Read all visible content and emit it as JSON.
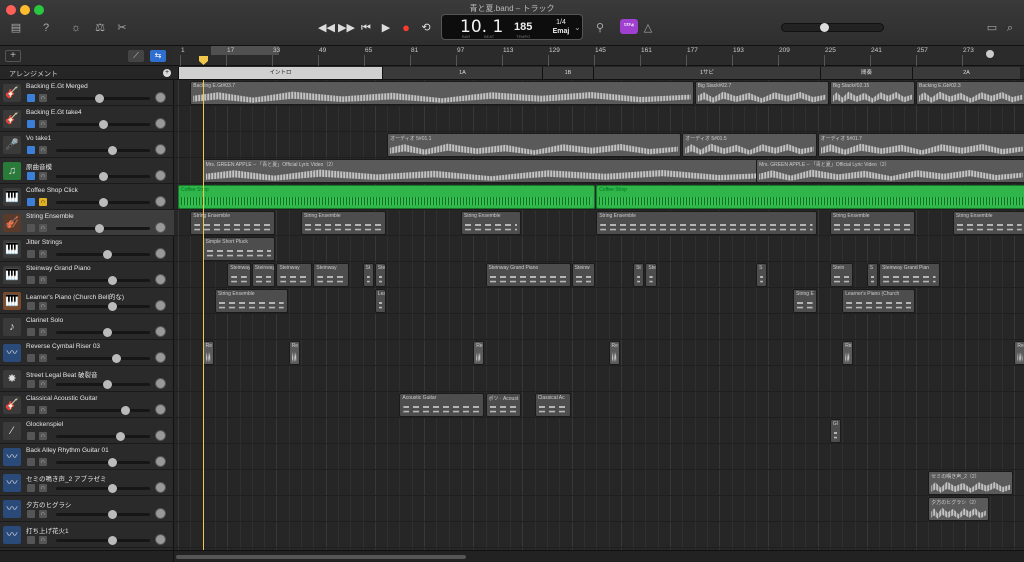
{
  "window": {
    "title": "青と夏.band – トラック"
  },
  "toolbar": {
    "library_icon": "library-icon",
    "help_icon": "help-icon",
    "smart_controls_icon": "smart-controls-icon",
    "editors_icon": "editors-icon",
    "lcd": {
      "position": "10. 1",
      "bar_label": "BAR",
      "beat_label": "BEAT",
      "tempo": "185",
      "tempo_label": "TEMPO",
      "signature": "1/4",
      "key": "Emaj"
    },
    "count_in_badge": "¹²³⁴",
    "volume_level": 0.4
  },
  "header": {
    "arrangement_label": "アレンジメント"
  },
  "ruler": {
    "ticks": [
      "1",
      "17",
      "33",
      "49",
      "65",
      "81",
      "97",
      "113",
      "129",
      "145",
      "161",
      "177",
      "193",
      "209",
      "225",
      "241",
      "257",
      "273"
    ]
  },
  "sections": [
    {
      "label": "イントロ"
    },
    {
      "label": "1A"
    },
    {
      "label": "1B"
    },
    {
      "label": "1サビ"
    },
    {
      "label": "間奏"
    },
    {
      "label": "2A"
    }
  ],
  "tracks": [
    {
      "name": "Backing E.Gt Merged",
      "icon": "🎸",
      "icon_bg": "#3a3a3a",
      "mute_on": true,
      "solo_on": false,
      "vol": 0.45
    },
    {
      "name": "Backing E.Gt take4",
      "icon": "🎸",
      "icon_bg": "#3a3a3a",
      "mute_on": true,
      "solo_on": false,
      "vol": 0.5
    },
    {
      "name": "Vo take1",
      "icon": "🎤",
      "icon_bg": "#3a3a3a",
      "mute_on": true,
      "solo_on": false,
      "vol": 0.6
    },
    {
      "name": "原曲音模",
      "icon": "♫",
      "icon_bg": "#2a7a3a",
      "mute_on": true,
      "solo_on": false,
      "vol": 0.5
    },
    {
      "name": "Coffee Shop Click",
      "icon": "🎹",
      "icon_bg": "#3a3a3a",
      "mute_on": true,
      "solo_on": true,
      "vol": 0.5
    },
    {
      "name": "String Ensemble",
      "icon": "🎻",
      "icon_bg": "#5a3a2a",
      "mute_on": false,
      "solo_on": false,
      "vol": 0.45
    },
    {
      "name": "Jitter Strings",
      "icon": "🎹",
      "icon_bg": "#3a3a3a",
      "mute_on": false,
      "solo_on": false,
      "vol": 0.55
    },
    {
      "name": "Steinway Grand Piano",
      "icon": "🎹",
      "icon_bg": "#3a3a3a",
      "mute_on": false,
      "solo_on": false,
      "vol": 0.6
    },
    {
      "name": "Learner's Piano (Church Bell的な)",
      "icon": "🎹",
      "icon_bg": "#7a4a2a",
      "mute_on": false,
      "solo_on": false,
      "vol": 0.6
    },
    {
      "name": "Clarinet Solo",
      "icon": "♪",
      "icon_bg": "#3a3a3a",
      "mute_on": false,
      "solo_on": false,
      "vol": 0.55
    },
    {
      "name": "Reverse Cymbal Riser 03",
      "icon": "〰",
      "icon_bg": "#2a4a7a",
      "mute_on": false,
      "solo_on": false,
      "vol": 0.65
    },
    {
      "name": "Street Legal Beat 破裂音",
      "icon": "✸",
      "icon_bg": "#3a3a3a",
      "mute_on": false,
      "solo_on": false,
      "vol": 0.55
    },
    {
      "name": "Classical Acoustic Guitar",
      "icon": "🎸",
      "icon_bg": "#3a3a3a",
      "mute_on": false,
      "solo_on": false,
      "vol": 0.75
    },
    {
      "name": "Glockenspiel",
      "icon": "⁄",
      "icon_bg": "#3a3a3a",
      "mute_on": false,
      "solo_on": false,
      "vol": 0.7
    },
    {
      "name": "Back Alley Rhythm Guitar 01",
      "icon": "〰",
      "icon_bg": "#2a4a7a",
      "mute_on": false,
      "solo_on": false,
      "vol": 0.6
    },
    {
      "name": "セミの鳴き声_2 アブラゼミ",
      "icon": "〰",
      "icon_bg": "#2a4a7a",
      "mute_on": false,
      "solo_on": false,
      "vol": 0.6
    },
    {
      "name": "夕方のヒグラシ",
      "icon": "〰",
      "icon_bg": "#2a4a7a",
      "mute_on": false,
      "solo_on": false,
      "vol": 0.6
    },
    {
      "name": "打ち上げ花火1",
      "icon": "〰",
      "icon_bg": "#2a4a7a",
      "mute_on": false,
      "solo_on": false,
      "vol": 0.6
    }
  ],
  "regions": [
    {
      "track": 0,
      "label": "Backing E.Gt#03.7",
      "kind": "audio",
      "start": 1,
      "len": 41
    },
    {
      "track": 0,
      "label": "Big Stack#02.7",
      "kind": "audio",
      "start": 42,
      "len": 11
    },
    {
      "track": 0,
      "label": "Big Stack#02.15",
      "kind": "audio",
      "start": 53,
      "len": 7
    },
    {
      "track": 0,
      "label": "Backing E.Gt#02.3",
      "kind": "audio",
      "start": 60,
      "len": 9
    },
    {
      "track": 2,
      "label": "オーディオ 5#01.1",
      "kind": "audio",
      "start": 17,
      "len": 24
    },
    {
      "track": 2,
      "label": "オーディオ 5#01.5",
      "kind": "audio",
      "start": 41,
      "len": 11
    },
    {
      "track": 2,
      "label": "オーディオ 5#01.7",
      "kind": "audio",
      "start": 52,
      "len": 17
    },
    {
      "track": 3,
      "label": "Mrs. GREEN APPLE – 「青と夏」Official Lyric Video（2）",
      "kind": "audio",
      "start": 2,
      "len": 47
    },
    {
      "track": 3,
      "label": "Mrs. GREEN APPLE – 「青と夏」Official Lyric Video（2）",
      "kind": "audio",
      "start": 47,
      "len": 22
    },
    {
      "track": 4,
      "label": "Coffee Shop",
      "kind": "green",
      "start": 0,
      "len": 34
    },
    {
      "track": 4,
      "label": "Coffee Shop",
      "kind": "green",
      "start": 34,
      "len": 35
    },
    {
      "track": 5,
      "label": "String Ensemble",
      "kind": "midi",
      "start": 1,
      "len": 7
    },
    {
      "track": 5,
      "label": "String Ensemble",
      "kind": "midi",
      "start": 10,
      "len": 7
    },
    {
      "track": 5,
      "label": "String Ensemble",
      "kind": "midi",
      "start": 23,
      "len": 5
    },
    {
      "track": 5,
      "label": "String Ensemble",
      "kind": "midi",
      "start": 34,
      "len": 18
    },
    {
      "track": 5,
      "label": "String Ensemble",
      "kind": "midi",
      "start": 53,
      "len": 7
    },
    {
      "track": 5,
      "label": "String Ensemble",
      "kind": "midi",
      "start": 63,
      "len": 6
    },
    {
      "track": 6,
      "label": "Simple Short Pluck",
      "kind": "midi",
      "start": 2,
      "len": 6
    },
    {
      "track": 7,
      "label": "Steinway",
      "kind": "midi",
      "start": 4,
      "len": 2
    },
    {
      "track": 7,
      "label": "Steinway",
      "kind": "midi",
      "start": 6,
      "len": 2
    },
    {
      "track": 7,
      "label": "Steinway",
      "kind": "midi",
      "start": 8,
      "len": 3
    },
    {
      "track": 7,
      "label": "Steinway",
      "kind": "midi",
      "start": 11,
      "len": 3
    },
    {
      "track": 7,
      "label": "St",
      "kind": "midi",
      "start": 15,
      "len": 1
    },
    {
      "track": 7,
      "label": "Stei",
      "kind": "midi",
      "start": 16,
      "len": 1
    },
    {
      "track": 7,
      "label": "Steinway Grand Piano",
      "kind": "midi",
      "start": 25,
      "len": 7
    },
    {
      "track": 7,
      "label": "Steinw",
      "kind": "midi",
      "start": 32,
      "len": 2
    },
    {
      "track": 7,
      "label": "St",
      "kind": "midi",
      "start": 37,
      "len": 1
    },
    {
      "track": 7,
      "label": "Ste",
      "kind": "midi",
      "start": 38,
      "len": 1
    },
    {
      "track": 7,
      "label": "S",
      "kind": "midi",
      "start": 47,
      "len": 1
    },
    {
      "track": 7,
      "label": "Stein",
      "kind": "midi",
      "start": 53,
      "len": 2
    },
    {
      "track": 7,
      "label": "S",
      "kind": "midi",
      "start": 56,
      "len": 1
    },
    {
      "track": 7,
      "label": "Steinway Grand Pian",
      "kind": "midi",
      "start": 57,
      "len": 5
    },
    {
      "track": 8,
      "label": "String Ensemble",
      "kind": "midi",
      "start": 3,
      "len": 6
    },
    {
      "track": 8,
      "label": "Learn",
      "kind": "midi",
      "start": 16,
      "len": 1
    },
    {
      "track": 8,
      "label": "String E",
      "kind": "midi",
      "start": 50,
      "len": 2
    },
    {
      "track": 8,
      "label": "Learner's Piano (Church",
      "kind": "midi",
      "start": 54,
      "len": 6
    },
    {
      "track": 10,
      "label": "Re",
      "kind": "audio",
      "start": 2,
      "len": 1
    },
    {
      "track": 10,
      "label": "Re",
      "kind": "audio",
      "start": 9,
      "len": 1
    },
    {
      "track": 10,
      "label": "Re",
      "kind": "audio",
      "start": 24,
      "len": 1
    },
    {
      "track": 10,
      "label": "Re",
      "kind": "audio",
      "start": 35,
      "len": 1
    },
    {
      "track": 10,
      "label": "Re",
      "kind": "audio",
      "start": 54,
      "len": 1
    },
    {
      "track": 10,
      "label": "Re",
      "kind": "audio",
      "start": 68,
      "len": 1
    },
    {
      "track": 12,
      "label": "Acoustic Guitar",
      "kind": "midi",
      "start": 18,
      "len": 7
    },
    {
      "track": 12,
      "label": "ポツ · Acoust",
      "kind": "midi",
      "start": 25,
      "len": 3
    },
    {
      "track": 12,
      "label": "Classical Ac",
      "kind": "midi",
      "start": 29,
      "len": 3
    },
    {
      "track": 13,
      "label": "Gl",
      "kind": "midi",
      "start": 53,
      "len": 1
    },
    {
      "track": 15,
      "label": "セミの鳴き声_2（2）",
      "kind": "audio",
      "start": 61,
      "len": 7
    },
    {
      "track": 16,
      "label": "夕方のヒグラシ（2）",
      "kind": "audio",
      "start": 61,
      "len": 5
    }
  ]
}
